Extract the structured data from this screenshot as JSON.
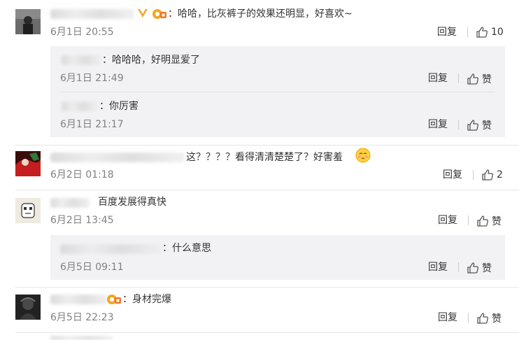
{
  "comments": [
    {
      "text": "：哈哈，比灰裤子的效果还明显，好喜欢~",
      "time": "6月1日 20:55",
      "reply_label": "回复",
      "like_count": "10",
      "replies": [
        {
          "text": "：哈哈哈，好明显爱了",
          "time": "6月1日 21:49",
          "reply_label": "回复",
          "like_label": "赞"
        },
        {
          "text": "：你厉害",
          "time": "6月1日 21:17",
          "reply_label": "回复",
          "like_label": "赞"
        }
      ]
    },
    {
      "text": "这？？？？看得清清楚楚了？好害羞",
      "time": "6月2日 01:18",
      "reply_label": "回复",
      "like_count": "2"
    },
    {
      "text": "百度发展得真快",
      "time": "6月2日 13:45",
      "reply_label": "回复",
      "like_label": "赞",
      "replies": [
        {
          "text": "：什么意思",
          "time": "6月5日 09:11",
          "reply_label": "回复",
          "like_label": "赞"
        }
      ]
    },
    {
      "text": "：身材完爆",
      "time": "6月5日 22:23",
      "reply_label": "回复",
      "like_label": "赞"
    }
  ],
  "colors": {
    "verified": "#f5a623",
    "reply_bg": "#f2f2f5",
    "time": "#808080"
  },
  "icons": {
    "like": "thumbs-up-icon",
    "verified": "verified-v-icon",
    "vip": "vip-badge-icon",
    "emoji": "shy-face-emoji"
  }
}
